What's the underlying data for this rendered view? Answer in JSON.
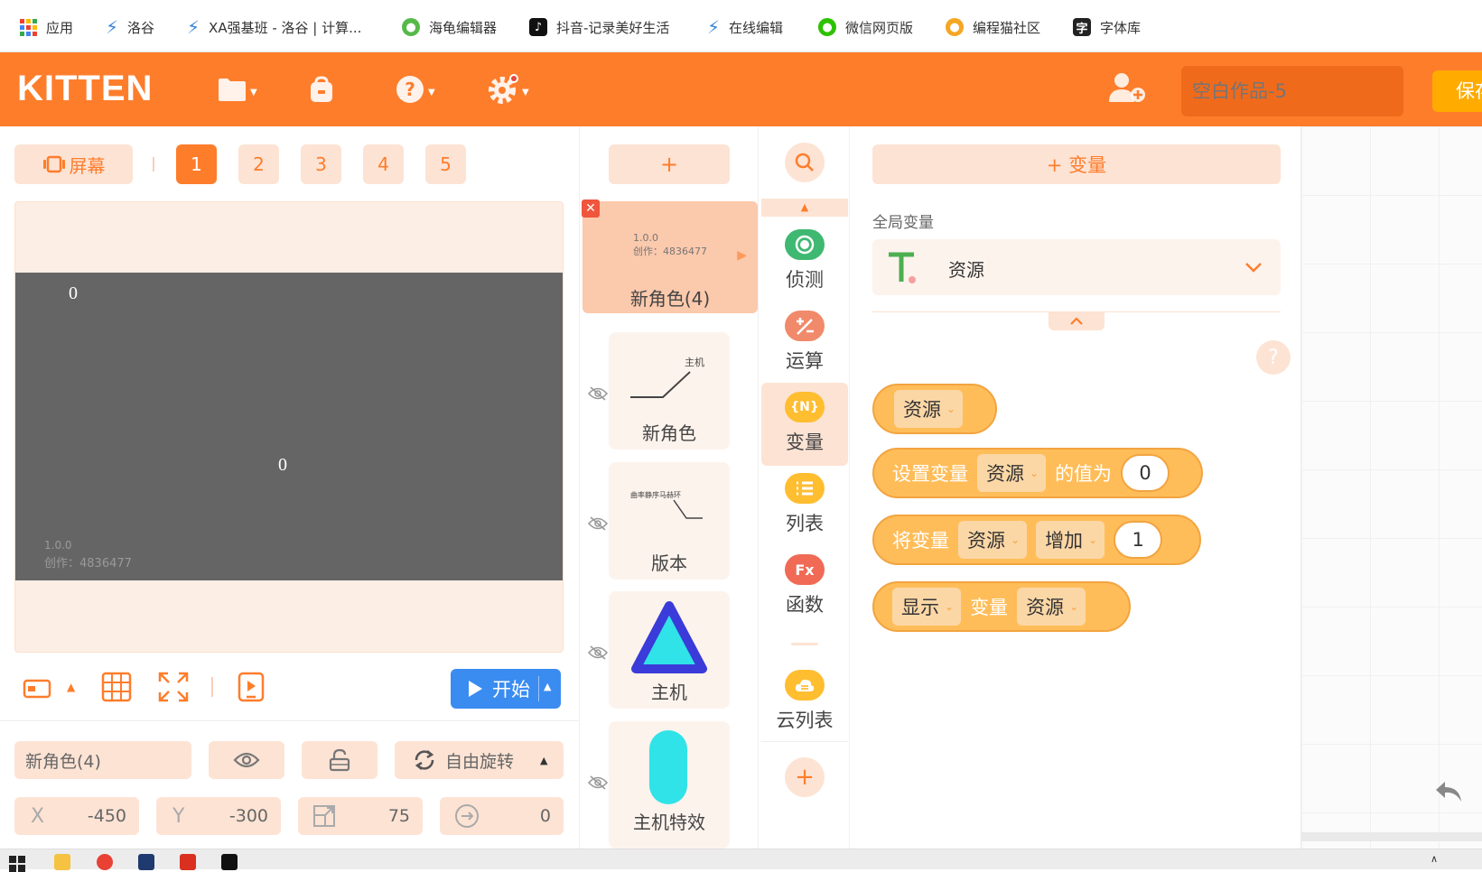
{
  "bookmarks": [
    {
      "label": "应用",
      "icon": "apps-grid-icon"
    },
    {
      "label": "洛谷",
      "icon": "luogu-icon"
    },
    {
      "label": "XA强基班 - 洛谷 | 计算...",
      "icon": "luogu-icon"
    },
    {
      "label": "海龟编辑器",
      "icon": "turtle-editor-icon"
    },
    {
      "label": "抖音-记录美好生活",
      "icon": "douyin-icon"
    },
    {
      "label": "在线编辑",
      "icon": "luogu-icon"
    },
    {
      "label": "微信网页版",
      "icon": "wechat-icon"
    },
    {
      "label": "编程猫社区",
      "icon": "codemao-icon"
    },
    {
      "label": "字体库",
      "icon": "font-library-icon"
    }
  ],
  "topbar": {
    "logo": "KITTEN",
    "project_title_placeholder": "空白作品-5",
    "save_label": "保存",
    "accent": "#fe7d2b"
  },
  "stage": {
    "screen_label": "屏幕",
    "screen_tabs": [
      "1",
      "2",
      "3",
      "4",
      "5"
    ],
    "active_tab": "1",
    "overlay_zero_1": "0",
    "overlay_zero_2": "0",
    "version_text": "1.0.0",
    "author_text": "创作：4836477",
    "start_label": "开始"
  },
  "sprite_props": {
    "name": "新角色(4)",
    "rotation_mode": "自由旋转",
    "x_label": "X",
    "x_value": "-450",
    "y_label": "Y",
    "y_value": "-300",
    "scale_value": "75",
    "direction_value": "0"
  },
  "sprites": {
    "add_label": "+",
    "items": [
      {
        "name": "新角色(4)",
        "thumb_line1": "1.0.0",
        "thumb_line2": "创作：4836477",
        "active": true
      },
      {
        "name": "新角色",
        "thumb_text": "主机"
      },
      {
        "name": "版本",
        "thumb_text": "曲率静序马赫环"
      },
      {
        "name": "主机"
      },
      {
        "name": "主机特效"
      }
    ]
  },
  "categories": [
    {
      "label": "侦测",
      "icon": "detect-icon",
      "color": "#3fb871"
    },
    {
      "label": "运算",
      "icon": "operator-icon",
      "color": "#f08a6b"
    },
    {
      "label": "变量",
      "icon": "variable-icon",
      "icon_text": "{N}",
      "color": "#ffbd30"
    },
    {
      "label": "列表",
      "icon": "list-icon",
      "color": "#ffbd30"
    },
    {
      "label": "函数",
      "icon": "function-icon",
      "icon_text": "Fx",
      "color": "#f06a55"
    },
    {
      "label": "云列表",
      "icon": "cloud-list-icon",
      "color": "#ffbd30"
    }
  ],
  "blocks_panel": {
    "add_variable_label": "+ 变量",
    "global_label": "全局变量",
    "selected_variable": "资源",
    "help_glyph": "?",
    "block_reporter": {
      "var": "资源"
    },
    "block_set": {
      "text1": "设置变量",
      "var": "资源",
      "text2": "的值为",
      "value": "0"
    },
    "block_change": {
      "text1": "将变量",
      "var": "资源",
      "op": "增加",
      "value": "1"
    },
    "block_show": {
      "op": "显示",
      "text1": "变量",
      "var": "资源"
    }
  }
}
